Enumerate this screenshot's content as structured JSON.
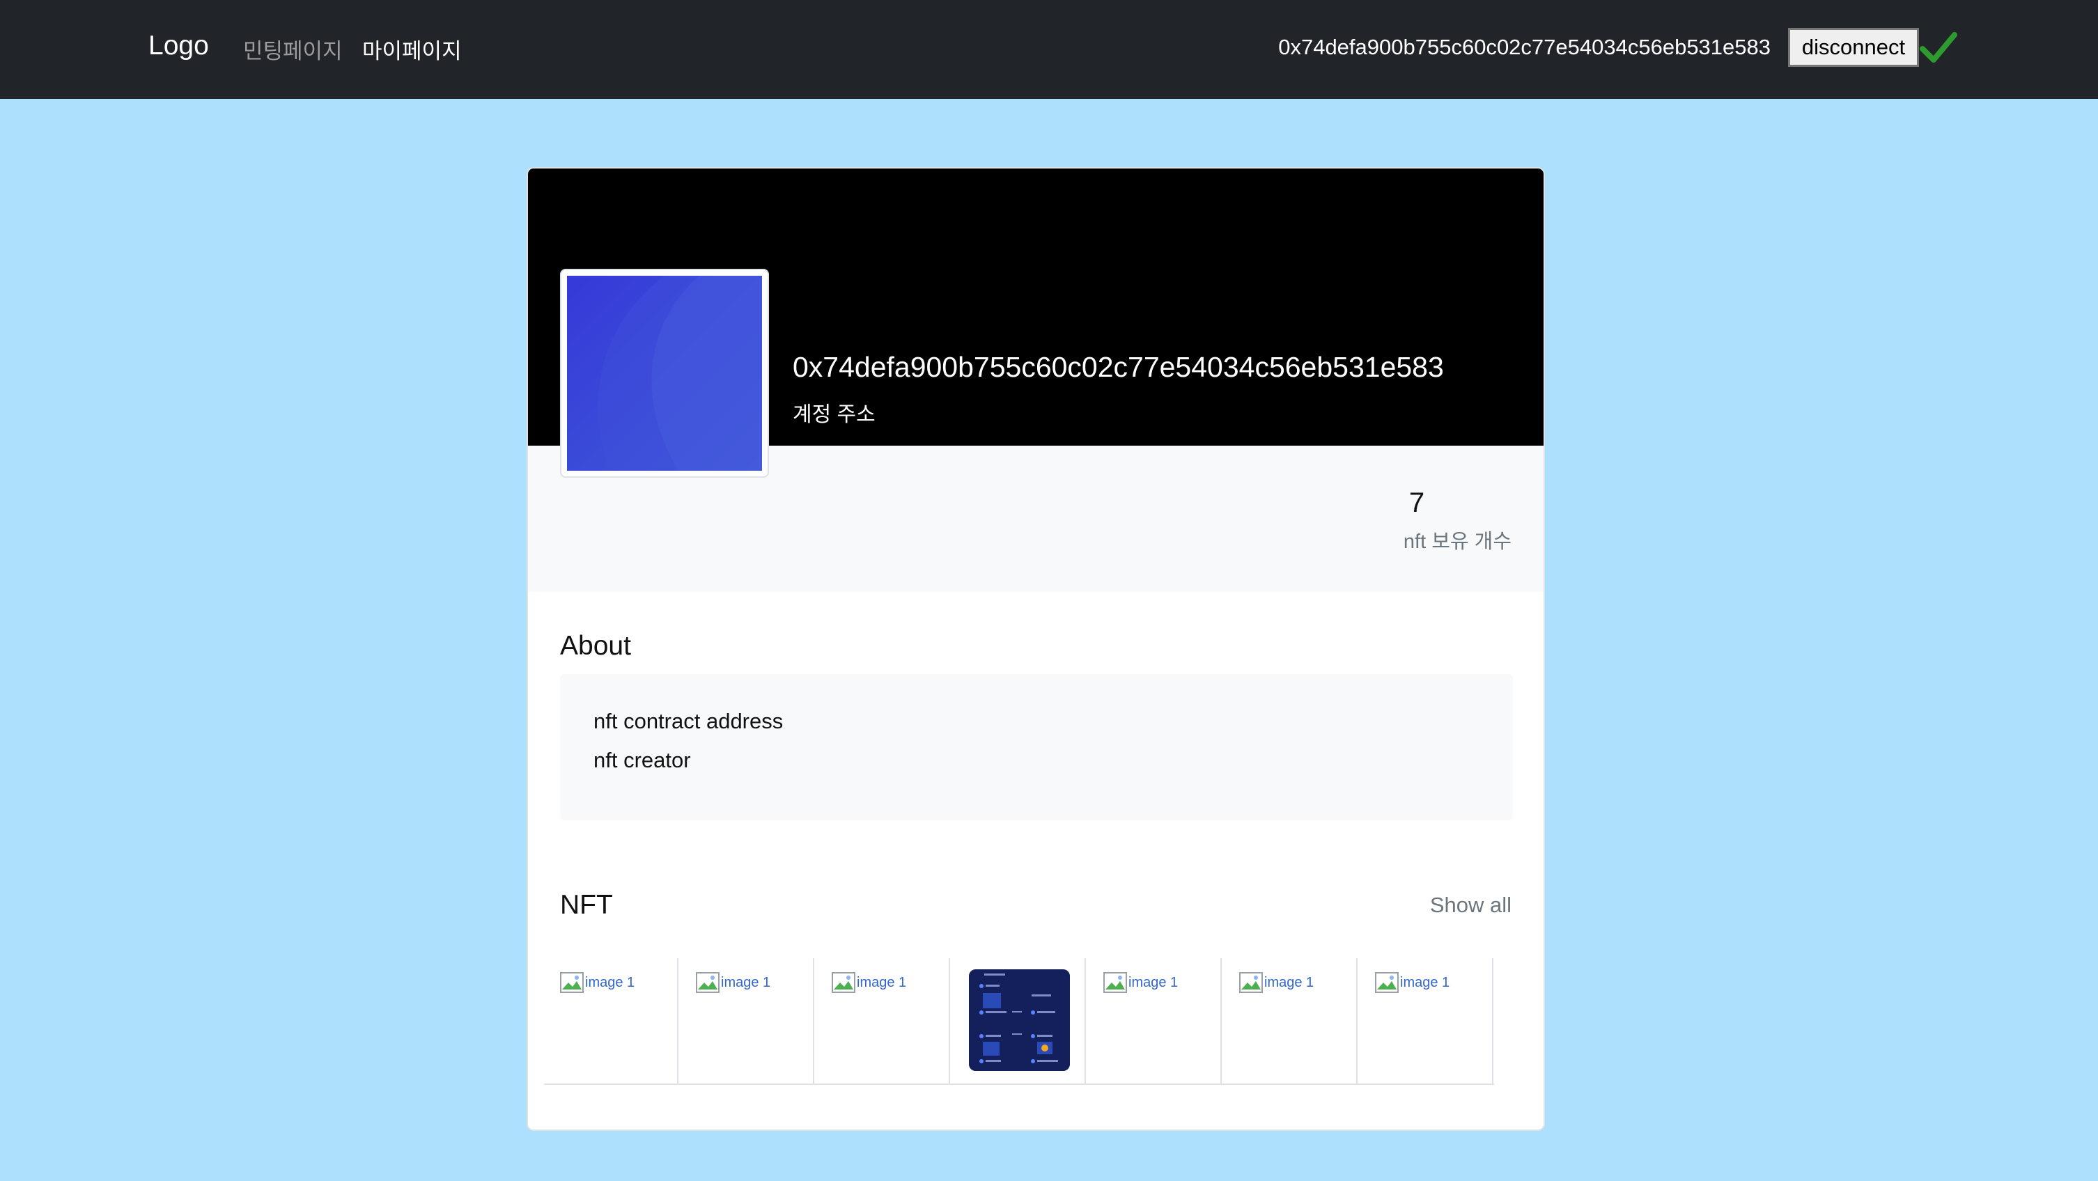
{
  "navbar": {
    "brand": "Logo",
    "links": [
      "민팅페이지",
      "마이페이지"
    ],
    "account": "0x74defa900b755c60c02c77e54034c56eb531e583",
    "disconnect_label": "disconnect",
    "check_color": "#2e9b2e"
  },
  "profile": {
    "address": "0x74defa900b755c60c02c77e54034c56eb531e583",
    "address_label": "계정 주소",
    "nft_count": "7",
    "nft_count_label": "nft 보유 개수"
  },
  "about": {
    "title": "About",
    "lines": [
      "nft contract address",
      "nft creator"
    ]
  },
  "nft": {
    "title": "NFT",
    "show_all": "Show all",
    "items": [
      {
        "alt": "image 1"
      },
      {
        "alt": "image 1"
      },
      {
        "alt": "image 1"
      },
      {
        "alt": ""
      },
      {
        "alt": "image 1"
      },
      {
        "alt": "image 1"
      },
      {
        "alt": "image 1"
      }
    ]
  }
}
